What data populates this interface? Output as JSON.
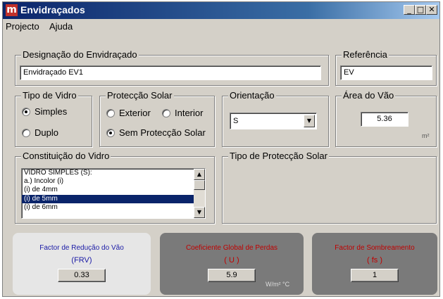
{
  "window": {
    "app_icon_letter": "m",
    "title": "Envidraçados",
    "minimize_glyph": "_",
    "maximize_glyph": "□",
    "close_glyph": "✕"
  },
  "menu": [
    "Projecto",
    "Ajuda"
  ],
  "designacao": {
    "label": "Designação do Envidraçado",
    "value": "Envidraçado EV1"
  },
  "referencia": {
    "label": "Referência",
    "value": "EV"
  },
  "tipo_vidro": {
    "label": "Tipo de Vidro",
    "options": [
      "Simples",
      "Duplo"
    ],
    "selected": "Simples"
  },
  "proteccao_solar": {
    "label": "Protecção Solar",
    "options": [
      "Exterior",
      "Interior",
      "Sem Protecção Solar"
    ],
    "selected": "Sem Protecção Solar"
  },
  "orientacao": {
    "label": "Orientação",
    "value": "S",
    "arrow_icon": "dropdown-arrow-icon"
  },
  "area_vao": {
    "label": "Área do Vão",
    "value": "5.36",
    "unit": "m²"
  },
  "constituicao_vidro": {
    "label": "Constituição do Vidro",
    "items": [
      "VIDRO SIMPLES (S):",
      "a.) Incolor (i)",
      "(i) de 4mm",
      "(i) de 5mm",
      "(i) de 6mm"
    ],
    "selected_index": 3
  },
  "tipo_proteccao_solar": {
    "label": "Tipo de Protecção Solar"
  },
  "results": {
    "frv": {
      "title": "Factor de Redução do Vão",
      "symbol": "(FRV)",
      "value": "0.33",
      "color": "#1a1aa6",
      "bg": "#e6e6e6"
    },
    "u": {
      "title": "Coeficiente Global de Perdas",
      "symbol": "( U )",
      "value": "5.9",
      "unit": "W/m² °C",
      "color": "#c00000",
      "bg": "#7a7a7a"
    },
    "fs": {
      "title": "Factor de Sombreamento",
      "symbol": "( fs )",
      "value": "1",
      "color": "#c00000",
      "bg": "#7a7a7a"
    }
  }
}
